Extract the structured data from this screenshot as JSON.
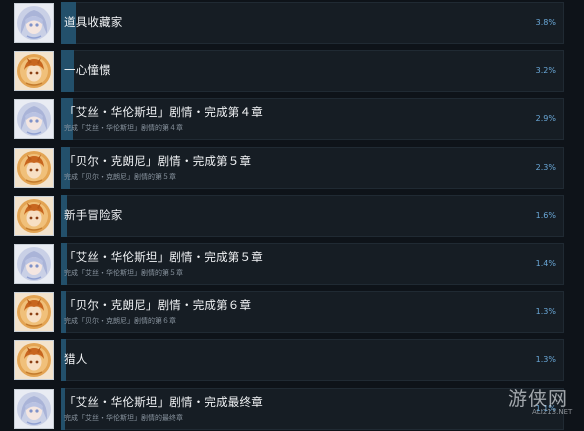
{
  "achievements": [
    {
      "title": "道具收藏家",
      "desc": "",
      "percent": "3.8%",
      "progress": 3.8,
      "icon": "silver-haired-girl-icon"
    },
    {
      "title": "一心憧憬",
      "desc": "",
      "percent": "3.2%",
      "progress": 3.2,
      "icon": "orange-haired-boy-icon"
    },
    {
      "title": "「艾丝・华伦斯坦」剧情・完成第４章",
      "desc": "完成「艾丝・华伦斯坦」剧情的第４章",
      "percent": "2.9%",
      "progress": 2.9,
      "icon": "silver-haired-girl-icon"
    },
    {
      "title": "「贝尔・克朗尼」剧情・完成第５章",
      "desc": "完成「贝尔・克朗尼」剧情的第５章",
      "percent": "2.3%",
      "progress": 2.3,
      "icon": "orange-haired-boy-icon"
    },
    {
      "title": "新手冒险家",
      "desc": "",
      "percent": "1.6%",
      "progress": 1.6,
      "icon": "orange-haired-boy-icon"
    },
    {
      "title": "「艾丝・华伦斯坦」剧情・完成第５章",
      "desc": "完成「艾丝・华伦斯坦」剧情的第５章",
      "percent": "1.4%",
      "progress": 1.4,
      "icon": "silver-haired-girl-icon"
    },
    {
      "title": "「贝尔・克朗尼」剧情・完成第６章",
      "desc": "完成「贝尔・克朗尼」剧情的第６章",
      "percent": "1.3%",
      "progress": 1.3,
      "icon": "orange-haired-boy-icon"
    },
    {
      "title": "猎人",
      "desc": "",
      "percent": "1.3%",
      "progress": 1.3,
      "icon": "orange-haired-boy-icon"
    },
    {
      "title": "「艾丝・华伦斯坦」剧情・完成最终章",
      "desc": "完成「艾丝・华伦斯坦」剧情的最终章",
      "percent": "1.1%",
      "progress": 1.1,
      "icon": "silver-haired-girl-icon"
    }
  ],
  "watermark": {
    "text": "游侠网",
    "sub": "ALI213.NET"
  },
  "colors": {
    "background": "#0e1319",
    "bar_fill": "#23506b",
    "percent_text": "#6aa8d8"
  }
}
